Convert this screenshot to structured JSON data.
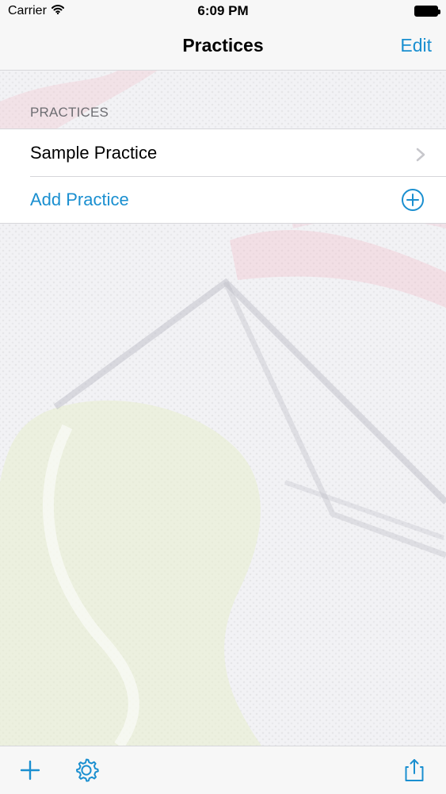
{
  "status_bar": {
    "carrier": "Carrier",
    "time": "6:09 PM"
  },
  "nav": {
    "title": "Practices",
    "edit_label": "Edit"
  },
  "section": {
    "header": "PRACTICES"
  },
  "table": {
    "rows": [
      {
        "label": "Sample Practice"
      },
      {
        "label": "Add Practice"
      }
    ]
  },
  "icons": {
    "wifi": "wifi-icon",
    "battery": "battery-icon",
    "chevron": "chevron-right-icon",
    "add": "plus-circle-icon",
    "toolbar_add": "plus-icon",
    "settings": "gear-icon",
    "share": "share-icon"
  },
  "colors": {
    "accent": "#1a8fd0",
    "secondary_text": "#6d6d72"
  }
}
